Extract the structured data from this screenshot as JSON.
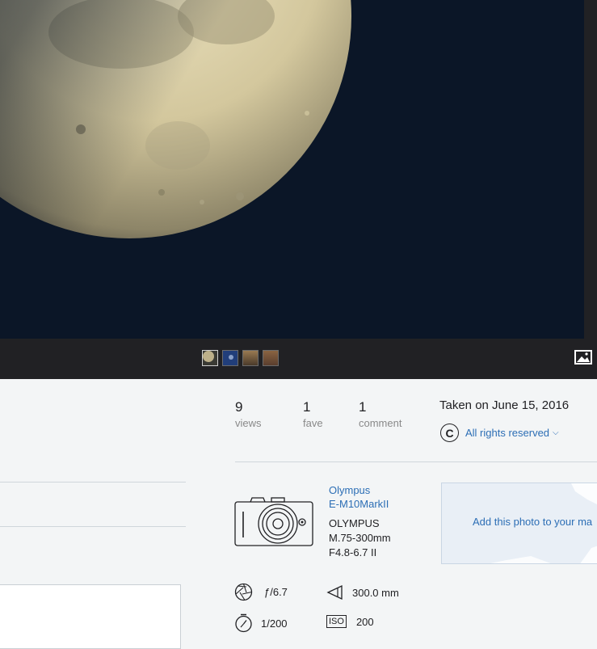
{
  "filmstrip": {
    "thumbnails": [
      {
        "name": "moon-crescent",
        "color": "#6b6b5a",
        "active": true
      },
      {
        "name": "moon-blue",
        "color": "#213e7a",
        "active": false
      },
      {
        "name": "sunset-1",
        "color": "#8a6a45",
        "active": false
      },
      {
        "name": "sunset-2",
        "color": "#7a5840",
        "active": false
      }
    ],
    "lightbox_icon": "image-icon"
  },
  "stats": [
    {
      "value": "9",
      "label": "views"
    },
    {
      "value": "1",
      "label": "fave"
    },
    {
      "value": "1",
      "label": "comment"
    }
  ],
  "taken": "Taken on June 15, 2016",
  "license": {
    "icon": "copyright-icon",
    "text": "All rights reserved"
  },
  "camera": {
    "make_model_line1": "Olympus",
    "make_model_line2": "E-M10MarkII",
    "lens_line1": "OLYMPUS",
    "lens_line2": "M.75-300mm",
    "lens_line3": "F4.8-6.7 II"
  },
  "map": {
    "text": "Add this photo to your ma"
  },
  "exif": {
    "aperture": "ƒ/6.7",
    "focal_length": "300.0 mm",
    "shutter": "1/200",
    "iso": "200",
    "iso_badge": "ISO"
  },
  "colors": {
    "link": "#2c6eb5",
    "sky": "#0b1627",
    "moon": "#d8cfa8"
  }
}
